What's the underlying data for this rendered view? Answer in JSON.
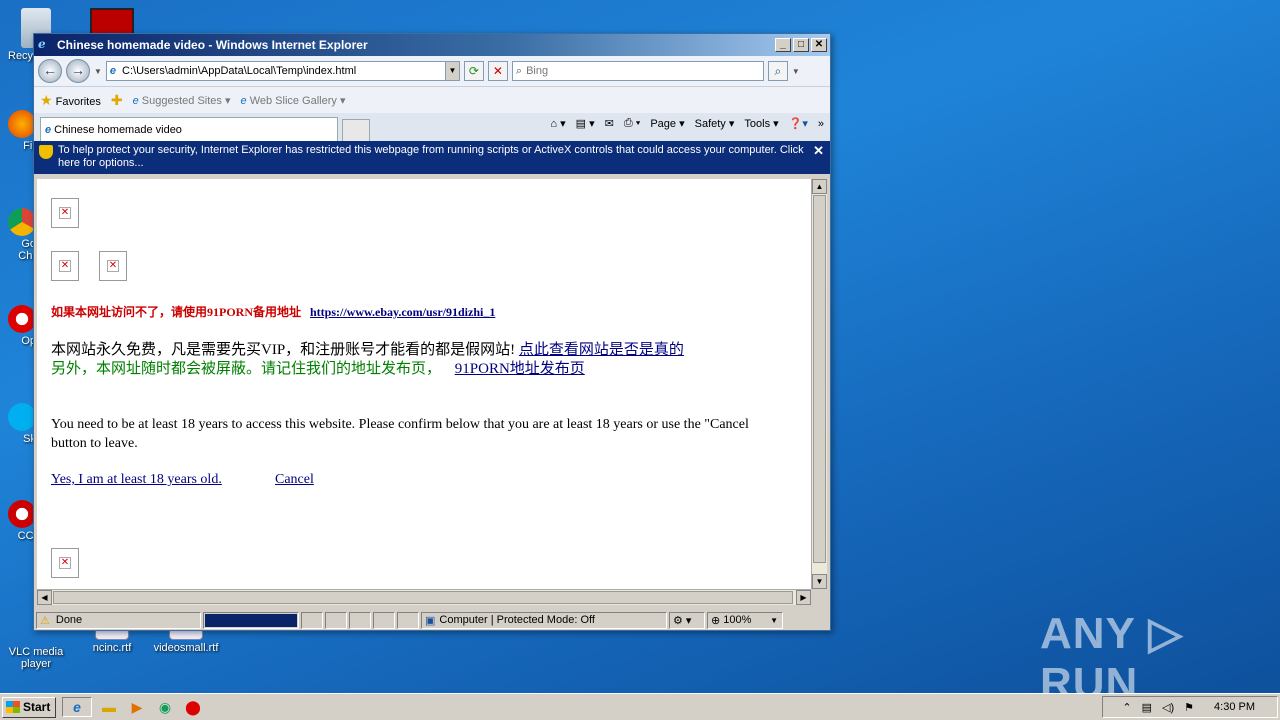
{
  "desktop": {
    "icons": [
      {
        "label": "Recy"
      },
      {
        "label": "Fir"
      },
      {
        "label": "Go\nChr"
      },
      {
        "label": "Op"
      },
      {
        "label": "Sk"
      },
      {
        "label": "CCl"
      },
      {
        "label": "VLC media player"
      },
      {
        "label": "ncinc.rtf"
      },
      {
        "label": "videosmall.rtf"
      }
    ],
    "watermark": "ANY ▷ RUN"
  },
  "window": {
    "title": "Chinese homemade video - Windows Internet Explorer",
    "address": "C:\\Users\\admin\\AppData\\Local\\Temp\\index.html",
    "search_placeholder": "Bing",
    "favorites_label": "Favorites",
    "suggested_sites": "Suggested Sites",
    "web_slice_gallery": "Web Slice Gallery",
    "tab_title": "Chinese homemade video",
    "commands": {
      "page": "Page",
      "safety": "Safety",
      "tools": "Tools"
    },
    "infobar_text": "To help protect your security, Internet Explorer has restricted this webpage from running scripts or ActiveX controls that could access your computer. Click here for options...",
    "status": {
      "text": "Done",
      "zone": "Computer | Protected Mode: Off",
      "zoom": "100%"
    }
  },
  "page": {
    "backup_notice": "如果本网址访问不了，请使用91PORN备用地址",
    "backup_link": "https://www.ebay.com/usr/91dizhi_1",
    "free_notice": "本网站永久免费，凡是需要先买VIP，和注册账号才能看的都是假网站!",
    "check_link": "点此查看网站是否是真的",
    "block_notice": "另外，本网址随时都会被屏蔽。请记住我们的地址发布页，",
    "publish_link": "91PORN地址发布页",
    "age_notice_line1": "You need to be at least 18 years to access this website. Please confirm below that you are at least 18 years or use the \"Cancel",
    "age_notice_line2": "button to leave.",
    "confirm_link": "Yes, I am at least 18 years old.",
    "cancel_link": "Cancel",
    "colors": {
      "red_text": "#cc0000",
      "green_text": "#008000",
      "link": "#000080"
    }
  },
  "taskbar": {
    "start_label": "Start",
    "clock": "4:30 PM"
  }
}
